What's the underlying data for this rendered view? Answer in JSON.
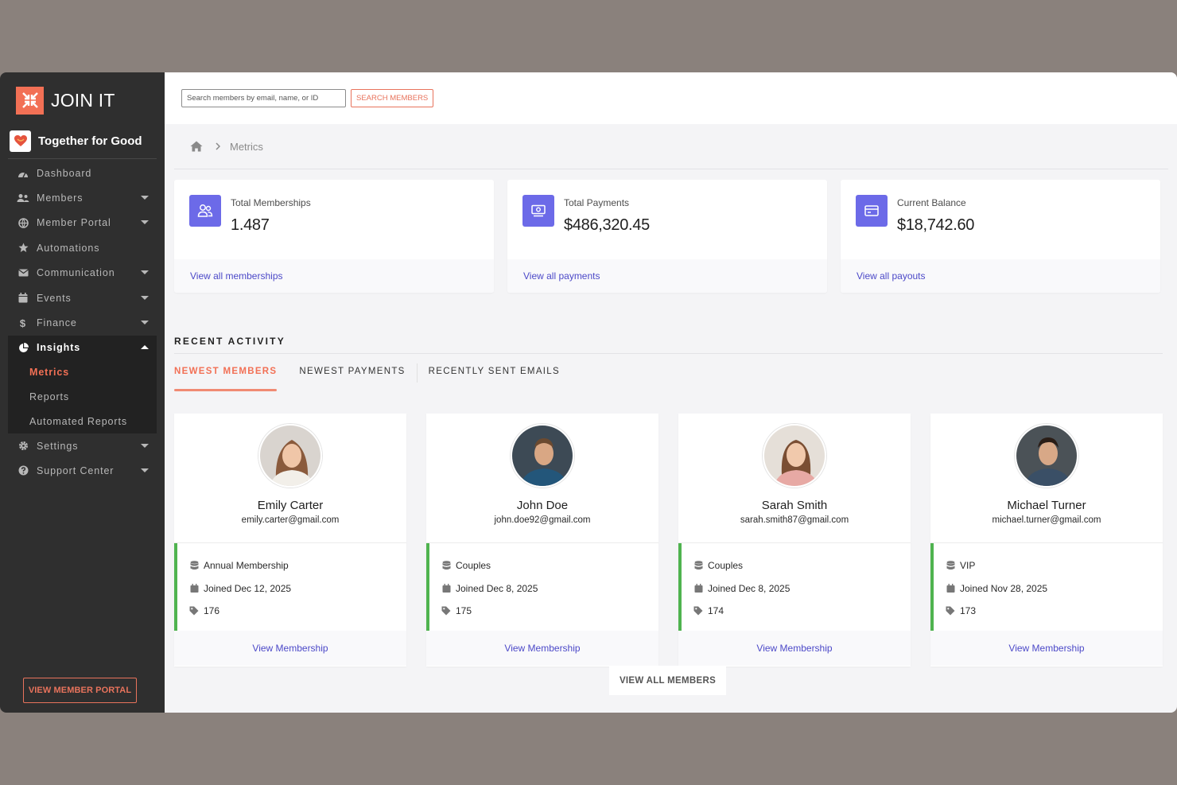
{
  "brand": {
    "name": "JOIN IT"
  },
  "org": {
    "name": "Together for Good"
  },
  "sidebar": {
    "items": [
      {
        "label": "Dashboard"
      },
      {
        "label": "Members"
      },
      {
        "label": "Member Portal"
      },
      {
        "label": "Automations"
      },
      {
        "label": "Communication"
      },
      {
        "label": "Events"
      },
      {
        "label": "Finance"
      },
      {
        "label": "Insights"
      },
      {
        "label": "Settings"
      },
      {
        "label": "Support Center"
      }
    ],
    "insights_sub": [
      {
        "label": "Metrics"
      },
      {
        "label": "Reports"
      },
      {
        "label": "Automated Reports"
      }
    ],
    "portal_button": "VIEW MEMBER PORTAL"
  },
  "search": {
    "placeholder": "Search members by email, name, or ID",
    "button": "SEARCH MEMBERS"
  },
  "breadcrumb": {
    "current": "Metrics"
  },
  "stats": [
    {
      "label": "Total Memberships",
      "value": "1.487",
      "link": "View all memberships"
    },
    {
      "label": "Total Payments",
      "value": "$486,320.45",
      "link": "View all payments"
    },
    {
      "label": "Current Balance",
      "value": "$18,742.60",
      "link": "View all payouts"
    }
  ],
  "recent_activity": {
    "title": "RECENT ACTIVITY",
    "tabs": [
      {
        "label": "NEWEST MEMBERS"
      },
      {
        "label": "NEWEST PAYMENTS"
      },
      {
        "label": "RECENTLY SENT EMAILS"
      }
    ]
  },
  "members": [
    {
      "name": "Emily Carter",
      "email": "emily.carter@gmail.com",
      "membership": "Annual Membership",
      "joined": "Joined Dec 12, 2025",
      "id": "176",
      "link": "View Membership"
    },
    {
      "name": "John Doe",
      "email": "john.doe92@gmail.com",
      "membership": "Couples",
      "joined": "Joined Dec 8, 2025",
      "id": "175",
      "link": "View Membership"
    },
    {
      "name": "Sarah Smith",
      "email": "sarah.smith87@gmail.com",
      "membership": "Couples",
      "joined": "Joined Dec 8, 2025",
      "id": "174",
      "link": "View Membership"
    },
    {
      "name": "Michael Turner",
      "email": "michael.turner@gmail.com",
      "membership": "VIP",
      "joined": "Joined Nov 28, 2025",
      "id": "173",
      "link": "View Membership"
    }
  ],
  "view_all_members": "VIEW ALL MEMBERS",
  "colors": {
    "accent": "#f27055",
    "stat_icon": "#6c6ae8",
    "link": "#4c49c8",
    "member_border": "#4fb34f",
    "sidebar_bg": "#2f2f2f"
  }
}
